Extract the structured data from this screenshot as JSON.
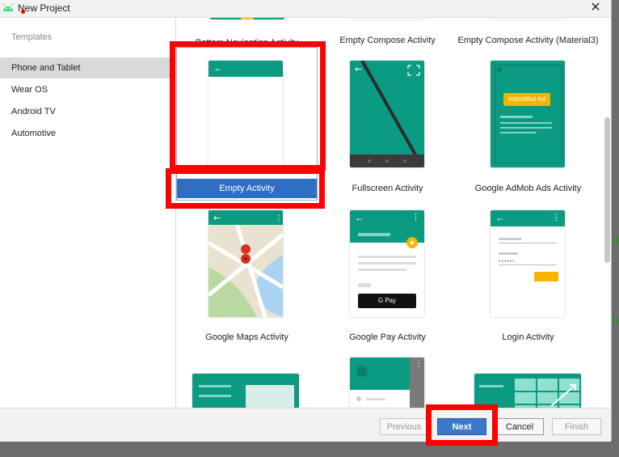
{
  "window": {
    "title": "New Project",
    "close_glyph": "✕"
  },
  "sidebar": {
    "heading": "Templates",
    "items": [
      {
        "label": "Phone and Tablet",
        "selected": true
      },
      {
        "label": "Wear OS"
      },
      {
        "label": "Android TV"
      },
      {
        "label": "Automotive"
      }
    ]
  },
  "templates": [
    {
      "label": "Bottom Navigation Activity"
    },
    {
      "label": "Empty Compose Activity"
    },
    {
      "label": "Empty Compose Activity (Material3)"
    },
    {
      "label": "Empty Activity",
      "selected": true
    },
    {
      "label": "Fullscreen Activity"
    },
    {
      "label": "Google AdMob Ads Activity",
      "ad_text": "Interstitial Ad"
    },
    {
      "label": "Google Maps Activity"
    },
    {
      "label": "Google Pay Activity",
      "pay_text": "G Pay"
    },
    {
      "label": "Login Activity"
    }
  ],
  "footer": {
    "previous": "Previous",
    "next": "Next",
    "cancel": "Cancel",
    "finish": "Finish"
  },
  "edge_glyphs": [
    "d",
    "u"
  ],
  "colors": {
    "teal": "#0b9a82",
    "selection_blue": "#2e6fc4",
    "highlight_red": "#ff0000"
  }
}
